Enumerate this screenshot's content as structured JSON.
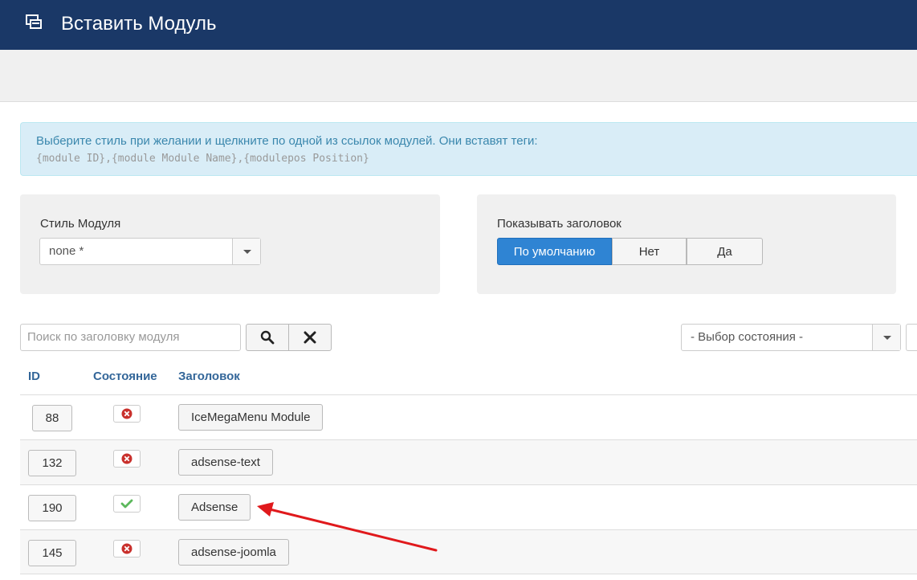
{
  "header": {
    "title": "Вставить Модуль",
    "icon": "module-icon"
  },
  "alert": {
    "text": "Выберите стиль при желании и щелкните по одной из ссылок модулей. Они вставят теги:",
    "code": "{module ID},{module Module Name},{modulepos Position}"
  },
  "module_style": {
    "label": "Стиль Модуля",
    "selected": "none *"
  },
  "show_title": {
    "label": "Показывать заголовок",
    "options": [
      "По умолчанию",
      "Нет",
      "Да"
    ],
    "active_index": 0
  },
  "filter": {
    "search_placeholder": "Поиск по заголовку модуля",
    "state_selected": "- Выбор состояния -"
  },
  "table": {
    "headers": {
      "id": "ID",
      "state": "Состояние",
      "title": "Заголовок"
    },
    "rows": [
      {
        "id": "88",
        "published": false,
        "title": "IceMegaMenu Module"
      },
      {
        "id": "132",
        "published": false,
        "title": "adsense-text"
      },
      {
        "id": "190",
        "published": true,
        "title": "Adsense"
      },
      {
        "id": "145",
        "published": false,
        "title": "adsense-joomla"
      }
    ]
  },
  "colors": {
    "header_bg": "#1a3867",
    "active_btn": "#2f84d3",
    "annotation_arrow": "#e0191c",
    "published": "#5cb85c",
    "unpublished": "#c9302c"
  }
}
